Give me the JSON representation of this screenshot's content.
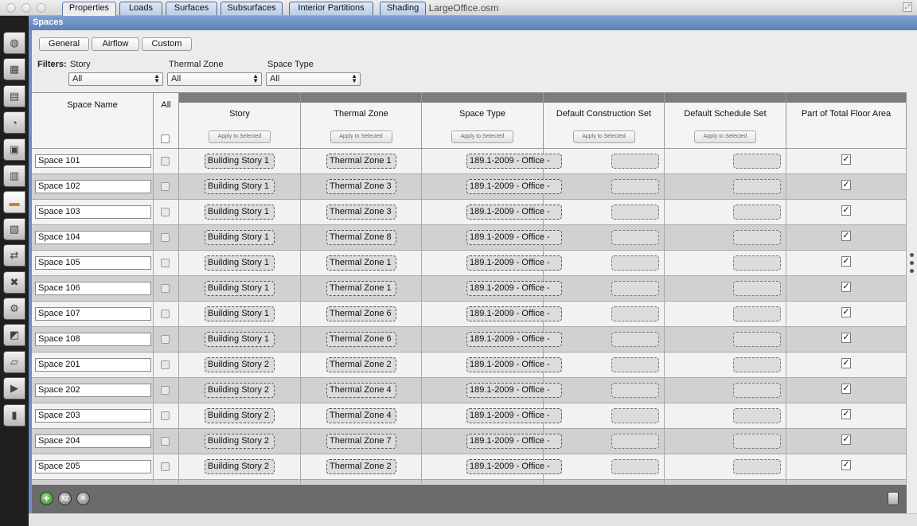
{
  "window": {
    "title": "LargeOffice.osm"
  },
  "nav_icons": [
    "site-icon",
    "schedules-icon",
    "constructions-icon",
    "loads-icon",
    "space-types-icon",
    "geometry-icon",
    "spaces-icon",
    "thermal-zones-icon",
    "hvac-systems-icon",
    "building-summary-icon",
    "variables-icon",
    "simulation-settings-icon",
    "scripts-icon",
    "run-icon",
    "results-icon"
  ],
  "section_label": "Spaces",
  "tabs": [
    {
      "label": "Properties",
      "active": true
    },
    {
      "label": "Loads"
    },
    {
      "label": "Surfaces"
    },
    {
      "label": "Subsurfaces"
    },
    {
      "label": "Interior Partitions"
    },
    {
      "label": "Shading"
    }
  ],
  "subtabs": [
    "General",
    "Airflow",
    "Custom"
  ],
  "filters": {
    "label": "Filters:",
    "story": {
      "label": "Story",
      "value": "All"
    },
    "thermal_zone": {
      "label": "Thermal Zone",
      "value": "All"
    },
    "space_type": {
      "label": "Space Type",
      "value": "All"
    }
  },
  "columns": {
    "space_name": "Space Name",
    "all": "All",
    "story": "Story",
    "thermal_zone": "Thermal Zone",
    "space_type": "Space Type",
    "default_construction_set": "Default Construction Set",
    "default_schedule_set": "Default Schedule Set",
    "part_of_total_floor_area": "Part of Total Floor Area",
    "apply_label": "Apply to Selected"
  },
  "rows": [
    {
      "name": "Space 101",
      "story": "Building Story 1",
      "zone": "Thermal Zone 1",
      "space_type": "189.1-2009 - Office -",
      "check": "✓"
    },
    {
      "name": "Space 102",
      "story": "Building Story 1",
      "zone": "Thermal Zone 3",
      "space_type": "189.1-2009 - Office -",
      "check": "✓"
    },
    {
      "name": "Space 103",
      "story": "Building Story 1",
      "zone": "Thermal Zone 3",
      "space_type": "189.1-2009 - Office -",
      "check": "✓"
    },
    {
      "name": "Space 104",
      "story": "Building Story 1",
      "zone": "Thermal Zone 8",
      "space_type": "189.1-2009 - Office -",
      "check": "✓"
    },
    {
      "name": "Space 105",
      "story": "Building Story 1",
      "zone": "Thermal Zone 1",
      "space_type": "189.1-2009 - Office -",
      "check": "✓"
    },
    {
      "name": "Space 106",
      "story": "Building Story 1",
      "zone": "Thermal Zone 1",
      "space_type": "189.1-2009 - Office -",
      "check": "✓"
    },
    {
      "name": "Space 107",
      "story": "Building Story 1",
      "zone": "Thermal Zone 6",
      "space_type": "189.1-2009 - Office -",
      "check": "✓"
    },
    {
      "name": "Space 108",
      "story": "Building Story 1",
      "zone": "Thermal Zone 6",
      "space_type": "189.1-2009 - Office -",
      "check": "✓"
    },
    {
      "name": "Space 201",
      "story": "Building Story 2",
      "zone": "Thermal Zone 2",
      "space_type": "189.1-2009 - Office -",
      "check": "✓"
    },
    {
      "name": "Space 202",
      "story": "Building Story 2",
      "zone": "Thermal Zone 4",
      "space_type": "189.1-2009 - Office -",
      "check": "✓"
    },
    {
      "name": "Space 203",
      "story": "Building Story 2",
      "zone": "Thermal Zone 4",
      "space_type": "189.1-2009 - Office -",
      "check": "✓"
    },
    {
      "name": "Space 204",
      "story": "Building Story 2",
      "zone": "Thermal Zone 7",
      "space_type": "189.1-2009 - Office -",
      "check": "✓"
    },
    {
      "name": "Space 205",
      "story": "Building Story 2",
      "zone": "Thermal Zone 2",
      "space_type": "189.1-2009 - Office -",
      "check": "✓"
    }
  ],
  "bottom_bar": {
    "add_icon": "plus-icon",
    "copy_icon": "copy-x2-icon",
    "copy_label": "X2",
    "delete_icon": "delete-x-icon",
    "purge_icon": "purge-icon"
  }
}
